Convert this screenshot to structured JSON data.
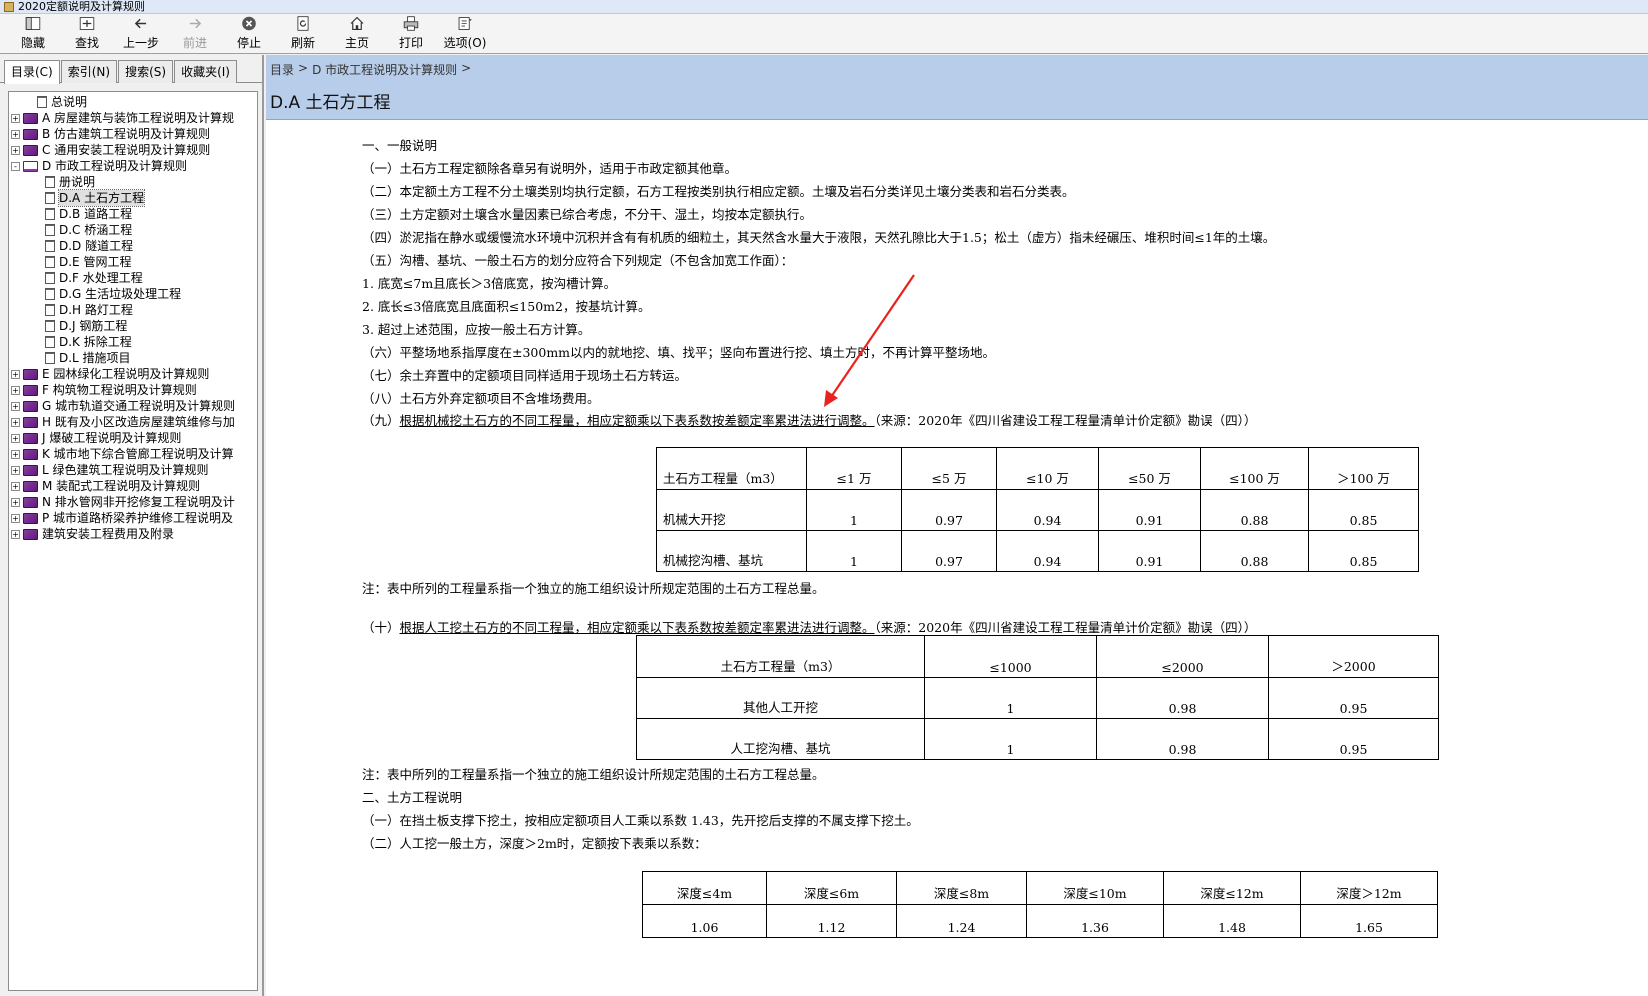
{
  "window": {
    "title": "2020定额说明及计算规则"
  },
  "toolbar": [
    {
      "label": "隐藏",
      "icon": "hide-icon",
      "enabled": true
    },
    {
      "label": "查找",
      "icon": "locate-icon",
      "enabled": true
    },
    {
      "label": "上一步",
      "icon": "back-arrow-icon",
      "enabled": true
    },
    {
      "label": "前进",
      "icon": "forward-arrow-icon",
      "enabled": false
    },
    {
      "label": "停止",
      "icon": "stop-icon",
      "enabled": true
    },
    {
      "label": "刷新",
      "icon": "refresh-icon",
      "enabled": true
    },
    {
      "label": "主页",
      "icon": "home-icon",
      "enabled": true
    },
    {
      "label": "打印",
      "icon": "print-icon",
      "enabled": true
    },
    {
      "label": "选项(O)",
      "icon": "options-icon",
      "enabled": true
    }
  ],
  "tabs": [
    "目录(C)",
    "索引(N)",
    "搜索(S)",
    "收藏夹(I)"
  ],
  "tree": [
    {
      "label": "总说明",
      "kind": "page",
      "level": 0,
      "expander": ""
    },
    {
      "label": "A 房屋建筑与装饰工程说明及计算规",
      "kind": "book",
      "level": 0,
      "expander": "+"
    },
    {
      "label": "B 仿古建筑工程说明及计算规则",
      "kind": "book",
      "level": 0,
      "expander": "+"
    },
    {
      "label": "C 通用安装工程说明及计算规则",
      "kind": "book",
      "level": 0,
      "expander": "+"
    },
    {
      "label": "D 市政工程说明及计算规则",
      "kind": "open",
      "level": 0,
      "expander": "-"
    },
    {
      "label": "册说明",
      "kind": "page",
      "level": 1,
      "expander": ""
    },
    {
      "label": "D.A 土石方工程",
      "kind": "page",
      "level": 1,
      "expander": "",
      "selected": true
    },
    {
      "label": "D.B 道路工程",
      "kind": "page",
      "level": 1,
      "expander": ""
    },
    {
      "label": "D.C 桥涵工程",
      "kind": "page",
      "level": 1,
      "expander": ""
    },
    {
      "label": "D.D 隧道工程",
      "kind": "page",
      "level": 1,
      "expander": ""
    },
    {
      "label": "D.E 管网工程",
      "kind": "page",
      "level": 1,
      "expander": ""
    },
    {
      "label": "D.F 水处理工程",
      "kind": "page",
      "level": 1,
      "expander": ""
    },
    {
      "label": "D.G 生活垃圾处理工程",
      "kind": "page",
      "level": 1,
      "expander": ""
    },
    {
      "label": "D.H 路灯工程",
      "kind": "page",
      "level": 1,
      "expander": ""
    },
    {
      "label": "D.J 钢筋工程",
      "kind": "page",
      "level": 1,
      "expander": ""
    },
    {
      "label": "D.K 拆除工程",
      "kind": "page",
      "level": 1,
      "expander": ""
    },
    {
      "label": "D.L 措施项目",
      "kind": "page",
      "level": 1,
      "expander": ""
    },
    {
      "label": "E 园林绿化工程说明及计算规则",
      "kind": "book",
      "level": 0,
      "expander": "+"
    },
    {
      "label": "F 构筑物工程说明及计算规则",
      "kind": "book",
      "level": 0,
      "expander": "+"
    },
    {
      "label": "G 城市轨道交通工程说明及计算规则",
      "kind": "book",
      "level": 0,
      "expander": "+"
    },
    {
      "label": "H 既有及小区改造房屋建筑维修与加",
      "kind": "book",
      "level": 0,
      "expander": "+"
    },
    {
      "label": "J 爆破工程说明及计算规则",
      "kind": "book",
      "level": 0,
      "expander": "+"
    },
    {
      "label": "K 城市地下综合管廊工程说明及计算",
      "kind": "book",
      "level": 0,
      "expander": "+"
    },
    {
      "label": "L 绿色建筑工程说明及计算规则",
      "kind": "book",
      "level": 0,
      "expander": "+"
    },
    {
      "label": "M 装配式工程说明及计算规则",
      "kind": "book",
      "level": 0,
      "expander": "+"
    },
    {
      "label": "N 排水管网非开挖修复工程说明及计",
      "kind": "book",
      "level": 0,
      "expander": "+"
    },
    {
      "label": "P 城市道路桥梁养护维修工程说明及",
      "kind": "book",
      "level": 0,
      "expander": "+"
    },
    {
      "label": "建筑安装工程费用及附录",
      "kind": "book",
      "level": 0,
      "expander": "+"
    }
  ],
  "main": {
    "breadcrumb": [
      "目录",
      ">",
      "D 市政工程说明及计算规则",
      ">"
    ],
    "title": "D.A 土石方工程",
    "lines": [
      {
        "pre": "一、一般说明",
        "ul": "",
        "post": ""
      },
      {
        "pre": "（一）土石方工程定额除各章另有说明外，适用于市政定额其他章。",
        "ul": "",
        "post": ""
      },
      {
        "pre": "（二）本定额土方工程不分土壤类别均执行定额，石方工程按类别执行相应定额。土壤及岩石分类详见土壤分类表和岩石分类表。",
        "ul": "",
        "post": ""
      },
      {
        "pre": "（三）土方定额对土壤含水量因素已综合考虑，不分干、湿土，均按本定额执行。",
        "ul": "",
        "post": ""
      },
      {
        "pre": "（四）淤泥指在静水或缓慢流水环境中沉积并含有有机质的细粒土，其天然含水量大于液限，天然孔隙比大于1.5；松土（虚方）指未经碾压、堆积时间≤1年的土壤。",
        "ul": "",
        "post": ""
      },
      {
        "pre": "（五）沟槽、基坑、一般土石方的划分应符合下列规定（不包含加宽工作面）：",
        "ul": "",
        "post": ""
      },
      {
        "pre": "1. 底宽≤7m且底长＞3倍底宽，按沟槽计算。",
        "ul": "",
        "post": ""
      },
      {
        "pre": "2. 底长≤3倍底宽且底面积≤150m2，按基坑计算。",
        "ul": "",
        "post": ""
      },
      {
        "pre": "3. 超过上述范围，应按一般土石方计算。",
        "ul": "",
        "post": ""
      },
      {
        "pre": "（六）平整场地系指厚度在±300mm以内的就地挖、填、找平；竖向布置进行挖、填土方时，不再计算平整场地。",
        "ul": "",
        "post": ""
      },
      {
        "pre": "（七）余土弃置中的定额项目同样适用于现场土石方转运。",
        "ul": "",
        "post": ""
      },
      {
        "pre": "（八）土石方外弃定额项目不含堆场费用。",
        "ul": "",
        "post": ""
      },
      {
        "pre": "（九）",
        "ul": "根据机械挖土石方的不同工程量，相应定额乘以下表系数按差额定率累进法进行调整。",
        "post": "（来源：2020年《四川省建设工程工程量清单计价定额》勘误（四））"
      }
    ],
    "table1": {
      "header": [
        "土石方工程量（m3）",
        "≤1 万",
        "≤5 万",
        "≤10 万",
        "≤50 万",
        "≤100 万",
        "＞100 万"
      ],
      "rows": [
        [
          "机械大开挖",
          "1",
          "0.97",
          "0.94",
          "0.91",
          "0.88",
          "0.85"
        ],
        [
          "机械挖沟槽、基坑",
          "1",
          "0.97",
          "0.94",
          "0.91",
          "0.88",
          "0.85"
        ]
      ]
    },
    "note1": "注：表中所列的工程量系指一个独立的施工组织设计所规定范围的土石方工程总量。",
    "line10": {
      "pre": "（十）",
      "ul": "根据人工挖土石方的不同工程量，相应定额乘以下表系数按差额定率累进法进行调整。",
      "post": "（来源：2020年《四川省建设工程工程量清单计价定额》勘误（四））"
    },
    "table2": {
      "header": [
        "土石方工程量（m3）",
        "≤1000",
        "≤2000",
        "＞2000"
      ],
      "rows": [
        [
          "其他人工开挖",
          "1",
          "0.98",
          "0.95"
        ],
        [
          "人工挖沟槽、基坑",
          "1",
          "0.98",
          "0.95"
        ]
      ]
    },
    "note2": "注：表中所列的工程量系指一个独立的施工组织设计所规定范围的土石方工程总量。",
    "section2": [
      "二、土方工程说明",
      "（一）在挡土板支撑下挖土，按相应定额项目人工乘以系数 1.43，先开挖后支撑的不属支撑下挖土。",
      "（二）人工挖一般土方，深度＞2m时，定额按下表乘以系数："
    ],
    "table3": {
      "header": [
        "深度≤4m",
        "深度≤6m",
        "深度≤8m",
        "深度≤10m",
        "深度≤12m",
        "深度＞12m"
      ],
      "row": [
        "1.06",
        "1.12",
        "1.24",
        "1.36",
        "1.48",
        "1.65"
      ]
    }
  },
  "colors": {
    "header_band": "#b8cde9",
    "arrow": "#e8231f",
    "book": "#8e3aa8"
  }
}
